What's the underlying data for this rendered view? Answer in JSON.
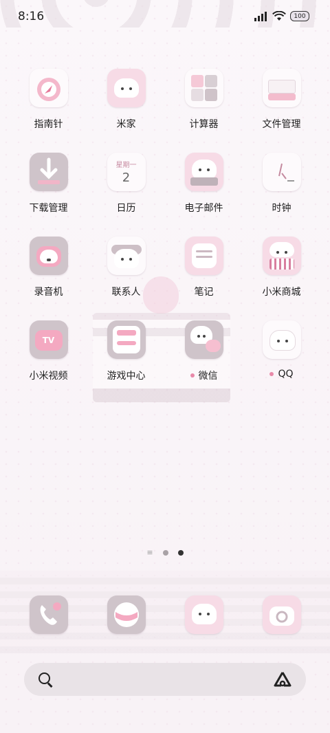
{
  "status_bar": {
    "time": "8:16",
    "battery": "100"
  },
  "apps": [
    {
      "label": "指南针",
      "icon": "compass-icon",
      "dot": false
    },
    {
      "label": "米家",
      "icon": "mijia-icon",
      "dot": false
    },
    {
      "label": "计算器",
      "icon": "calculator-icon",
      "dot": false
    },
    {
      "label": "文件管理",
      "icon": "file-manager-icon",
      "dot": false
    },
    {
      "label": "下载管理",
      "icon": "download-icon",
      "dot": false
    },
    {
      "label": "日历",
      "icon": "calendar-icon",
      "dot": false,
      "calendar_weekday": "星期一",
      "calendar_day": "2"
    },
    {
      "label": "电子邮件",
      "icon": "email-icon",
      "dot": false
    },
    {
      "label": "时钟",
      "icon": "clock-icon",
      "dot": false
    },
    {
      "label": "录音机",
      "icon": "recorder-icon",
      "dot": false
    },
    {
      "label": "联系人",
      "icon": "contacts-icon",
      "dot": false
    },
    {
      "label": "笔记",
      "icon": "notes-icon",
      "dot": false
    },
    {
      "label": "小米商城",
      "icon": "mi-store-icon",
      "dot": false
    },
    {
      "label": "小米视频",
      "icon": "mi-video-icon",
      "dot": false,
      "tv_text": "TV"
    },
    {
      "label": "游戏中心",
      "icon": "game-center-icon",
      "dot": false
    },
    {
      "label": "微信",
      "icon": "wechat-icon",
      "dot": true
    },
    {
      "label": "QQ",
      "icon": "qq-icon",
      "dot": true
    }
  ],
  "page_indicator": {
    "pages": 2,
    "active": 2
  },
  "dock": [
    {
      "icon": "phone-icon"
    },
    {
      "icon": "browser-icon"
    },
    {
      "icon": "messages-icon"
    },
    {
      "icon": "camera-icon"
    }
  ],
  "search": {
    "search_icon": "search-icon",
    "assistant_icon": "assistant-icon"
  }
}
